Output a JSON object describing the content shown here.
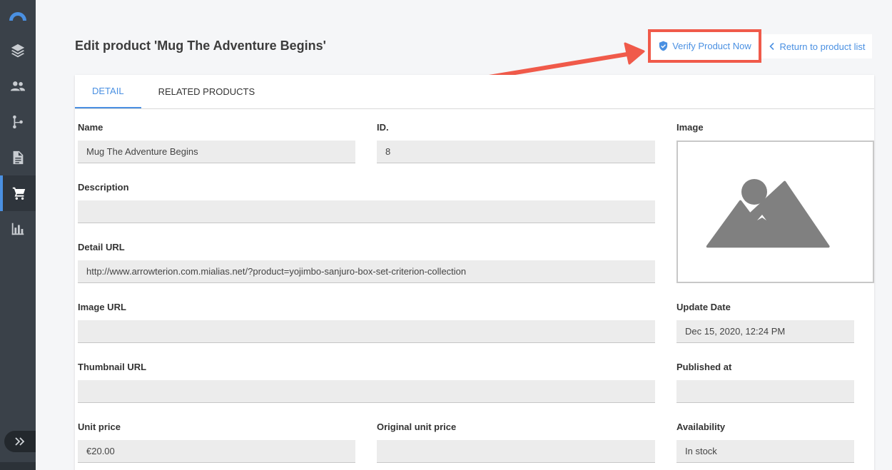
{
  "page": {
    "title": "Edit product 'Mug The Adventure Begins'"
  },
  "actions": {
    "verify_label": "Verify Product Now",
    "return_label": "Return to product list"
  },
  "tabs": [
    {
      "label": "DETAIL",
      "active": true
    },
    {
      "label": "RELATED PRODUCTS",
      "active": false
    }
  ],
  "fields": {
    "name": {
      "label": "Name",
      "value": "Mug The Adventure Begins"
    },
    "id": {
      "label": "ID.",
      "value": "8"
    },
    "image": {
      "label": "Image"
    },
    "description": {
      "label": "Description",
      "value": ""
    },
    "detail_url": {
      "label": "Detail URL",
      "value": "http://www.arrowterion.com.mialias.net/?product=yojimbo-sanjuro-box-set-criterion-collection"
    },
    "image_url": {
      "label": "Image URL",
      "value": ""
    },
    "update_date": {
      "label": "Update Date",
      "value": "Dec 15, 2020, 12:24 PM"
    },
    "thumbnail_url": {
      "label": "Thumbnail URL",
      "value": ""
    },
    "published_at": {
      "label": "Published at",
      "value": ""
    },
    "unit_price": {
      "label": "Unit price",
      "value": "€20.00"
    },
    "original_unit_price": {
      "label": "Original unit price",
      "value": ""
    },
    "availability": {
      "label": "Availability",
      "value": "In stock"
    }
  },
  "sidebar": {
    "items": [
      {
        "icon": "layers-icon"
      },
      {
        "icon": "users-icon"
      },
      {
        "icon": "branch-icon"
      },
      {
        "icon": "document-icon"
      },
      {
        "icon": "cart-icon",
        "active": true
      },
      {
        "icon": "bar-chart-icon"
      }
    ],
    "expand_icon": "double-chevron-right-icon"
  },
  "colors": {
    "accent": "#4a90e2",
    "highlight": "#f05a4a",
    "sidebar": "#3a4149"
  }
}
